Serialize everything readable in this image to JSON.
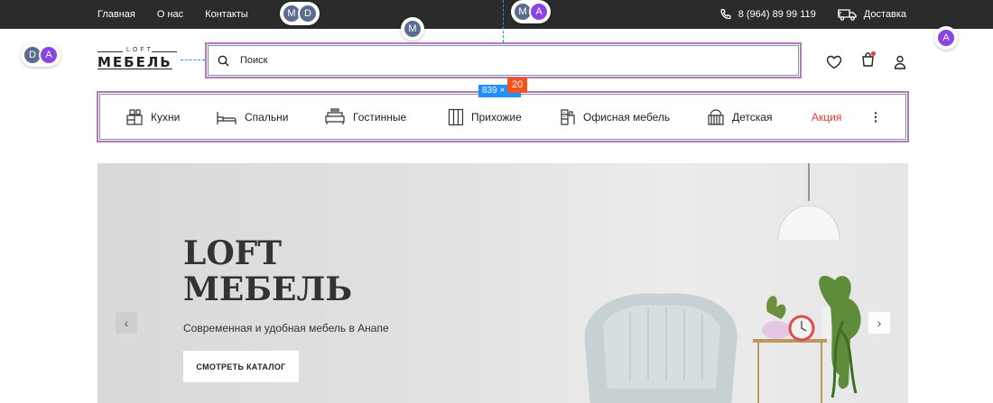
{
  "topbar": {
    "nav": [
      "Главная",
      "О нас",
      "Контакты"
    ],
    "phone": "8 (964) 89 99 119",
    "delivery": "Доставка",
    "phone_icon": "phone-icon",
    "delivery_icon": "truck-icon"
  },
  "header": {
    "logo_small": "LOFT",
    "logo_main": "МЕБЕЛЬ",
    "search_placeholder": "Поиск",
    "icons": [
      "heart-icon",
      "cart-icon",
      "user-icon"
    ]
  },
  "categories": [
    {
      "label": "Кухни",
      "icon": "kitchen-icon"
    },
    {
      "label": "Спальни",
      "icon": "bed-icon"
    },
    {
      "label": "Гостинные",
      "icon": "sofa-icon"
    },
    {
      "label": "Прихожие",
      "icon": "wardrobe-icon"
    },
    {
      "label": "Офисная мебель",
      "icon": "office-icon"
    },
    {
      "label": "Детская",
      "icon": "crib-icon"
    },
    {
      "label": "Акция",
      "icon": ""
    }
  ],
  "more_icon": "more-vertical-icon",
  "hero": {
    "title": "LOFT\nМЕБЕЛЬ",
    "subtitle": "Современная и удобная мебель в Анапе",
    "button": "СМОТРЕТЬ КАТАЛОГ",
    "prev": "‹",
    "next": "›"
  },
  "overlay": {
    "dimensions": "839 × 56",
    "badge": "20",
    "avatars_top": [
      "M",
      "D"
    ],
    "avatar_mid": "M",
    "avatars_topright": [
      "M",
      "A"
    ],
    "avatars_left": [
      "D",
      "A"
    ],
    "avatar_right": "A"
  },
  "colors": {
    "topbar": "#2b2b2b",
    "sale": "#e53935",
    "selection": "#b27ab7",
    "guide": "#1e90ff",
    "badge": "#f4511e"
  }
}
